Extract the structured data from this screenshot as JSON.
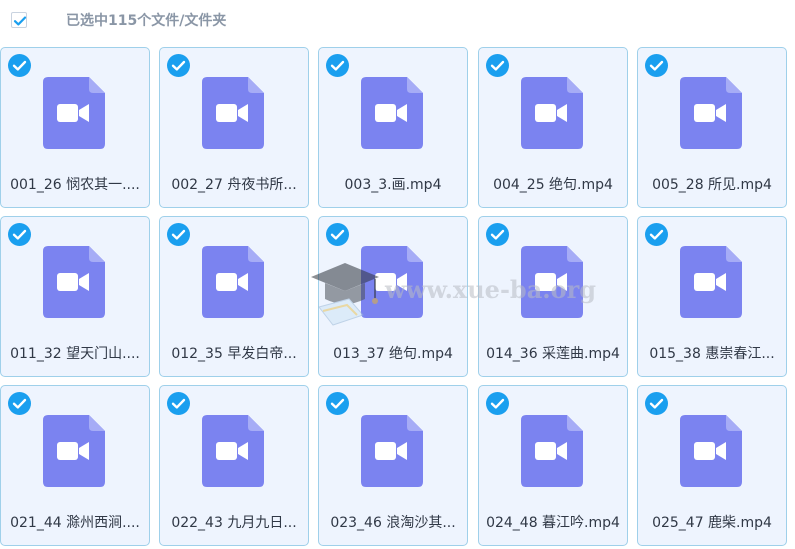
{
  "header": {
    "selection_text": "已选中115个文件/文件夹"
  },
  "files": [
    {
      "name": "001_26 悯农其一...."
    },
    {
      "name": "002_27 舟夜书所..."
    },
    {
      "name": "003_3.画.mp4"
    },
    {
      "name": "004_25 绝句.mp4"
    },
    {
      "name": "005_28 所见.mp4"
    },
    {
      "name": "011_32 望天门山...."
    },
    {
      "name": "012_35 早发白帝..."
    },
    {
      "name": "013_37 绝句.mp4"
    },
    {
      "name": "014_36 采莲曲.mp4"
    },
    {
      "name": "015_38 惠崇春江..."
    },
    {
      "name": "021_44 滁州西涧...."
    },
    {
      "name": "022_43 九月九日..."
    },
    {
      "name": "023_46 浪淘沙其..."
    },
    {
      "name": "024_48 暮江吟.mp4"
    },
    {
      "name": "025_47 鹿柴.mp4"
    }
  ],
  "watermark": {
    "text": "www.xue-ba.org"
  },
  "colors": {
    "accent": "#1a9fef",
    "file_icon": "#7b83f0",
    "card_bg": "#eef4fe",
    "card_border": "#9fd0ea"
  }
}
